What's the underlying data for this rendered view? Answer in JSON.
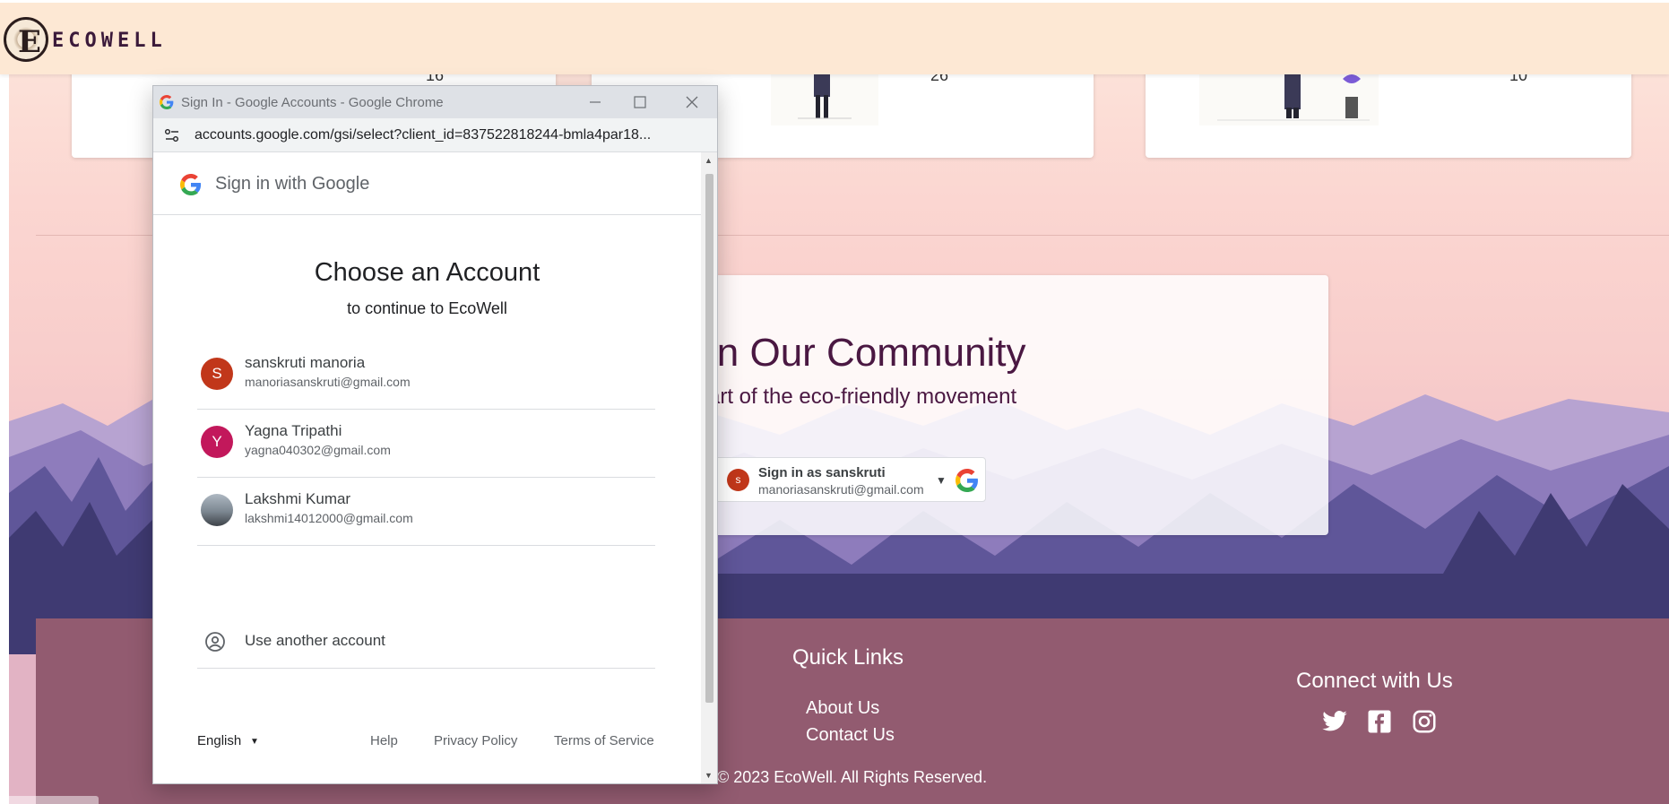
{
  "site": {
    "logo_letter": "E",
    "logo_text": "ECOWELL",
    "stats": [
      "16",
      "26",
      "10"
    ],
    "community": {
      "title": "in Our Community",
      "subtitle": "art of the eco-friendly movement",
      "gsi_button": {
        "avatar_letter": "s",
        "name": "Sign in as sanskruti",
        "email": "manoriasanskruti@gmail.com"
      }
    },
    "footer": {
      "quick_links_heading": "Quick Links",
      "links": [
        "About Us",
        "Contact Us"
      ],
      "connect_heading": "Connect with Us",
      "social": [
        "twitter-icon",
        "facebook-icon",
        "instagram-icon"
      ],
      "copyright": "© 2023 EcoWell. All Rights Reserved."
    }
  },
  "popup": {
    "window_title": "Sign In - Google Accounts - Google Chrome",
    "url": "accounts.google.com/gsi/select?client_id=837522818244-bmla4par18...",
    "header": "Sign in with Google",
    "title": "Choose an Account",
    "subtitle": "to continue to EcoWell",
    "accounts": [
      {
        "initial": "S",
        "name": "sanskruti manoria",
        "email": "manoriasanskruti@gmail.com",
        "color": "#c1371a"
      },
      {
        "initial": "Y",
        "name": "Yagna Tripathi",
        "email": "yagna040302@gmail.com",
        "color": "#c2185b"
      },
      {
        "initial": "",
        "name": "Lakshmi Kumar",
        "email": "lakshmi14012000@gmail.com",
        "color": "#6e7b86"
      }
    ],
    "use_another": "Use another account",
    "footer": {
      "language": "English",
      "help": "Help",
      "privacy": "Privacy Policy",
      "terms": "Terms of Service"
    }
  }
}
